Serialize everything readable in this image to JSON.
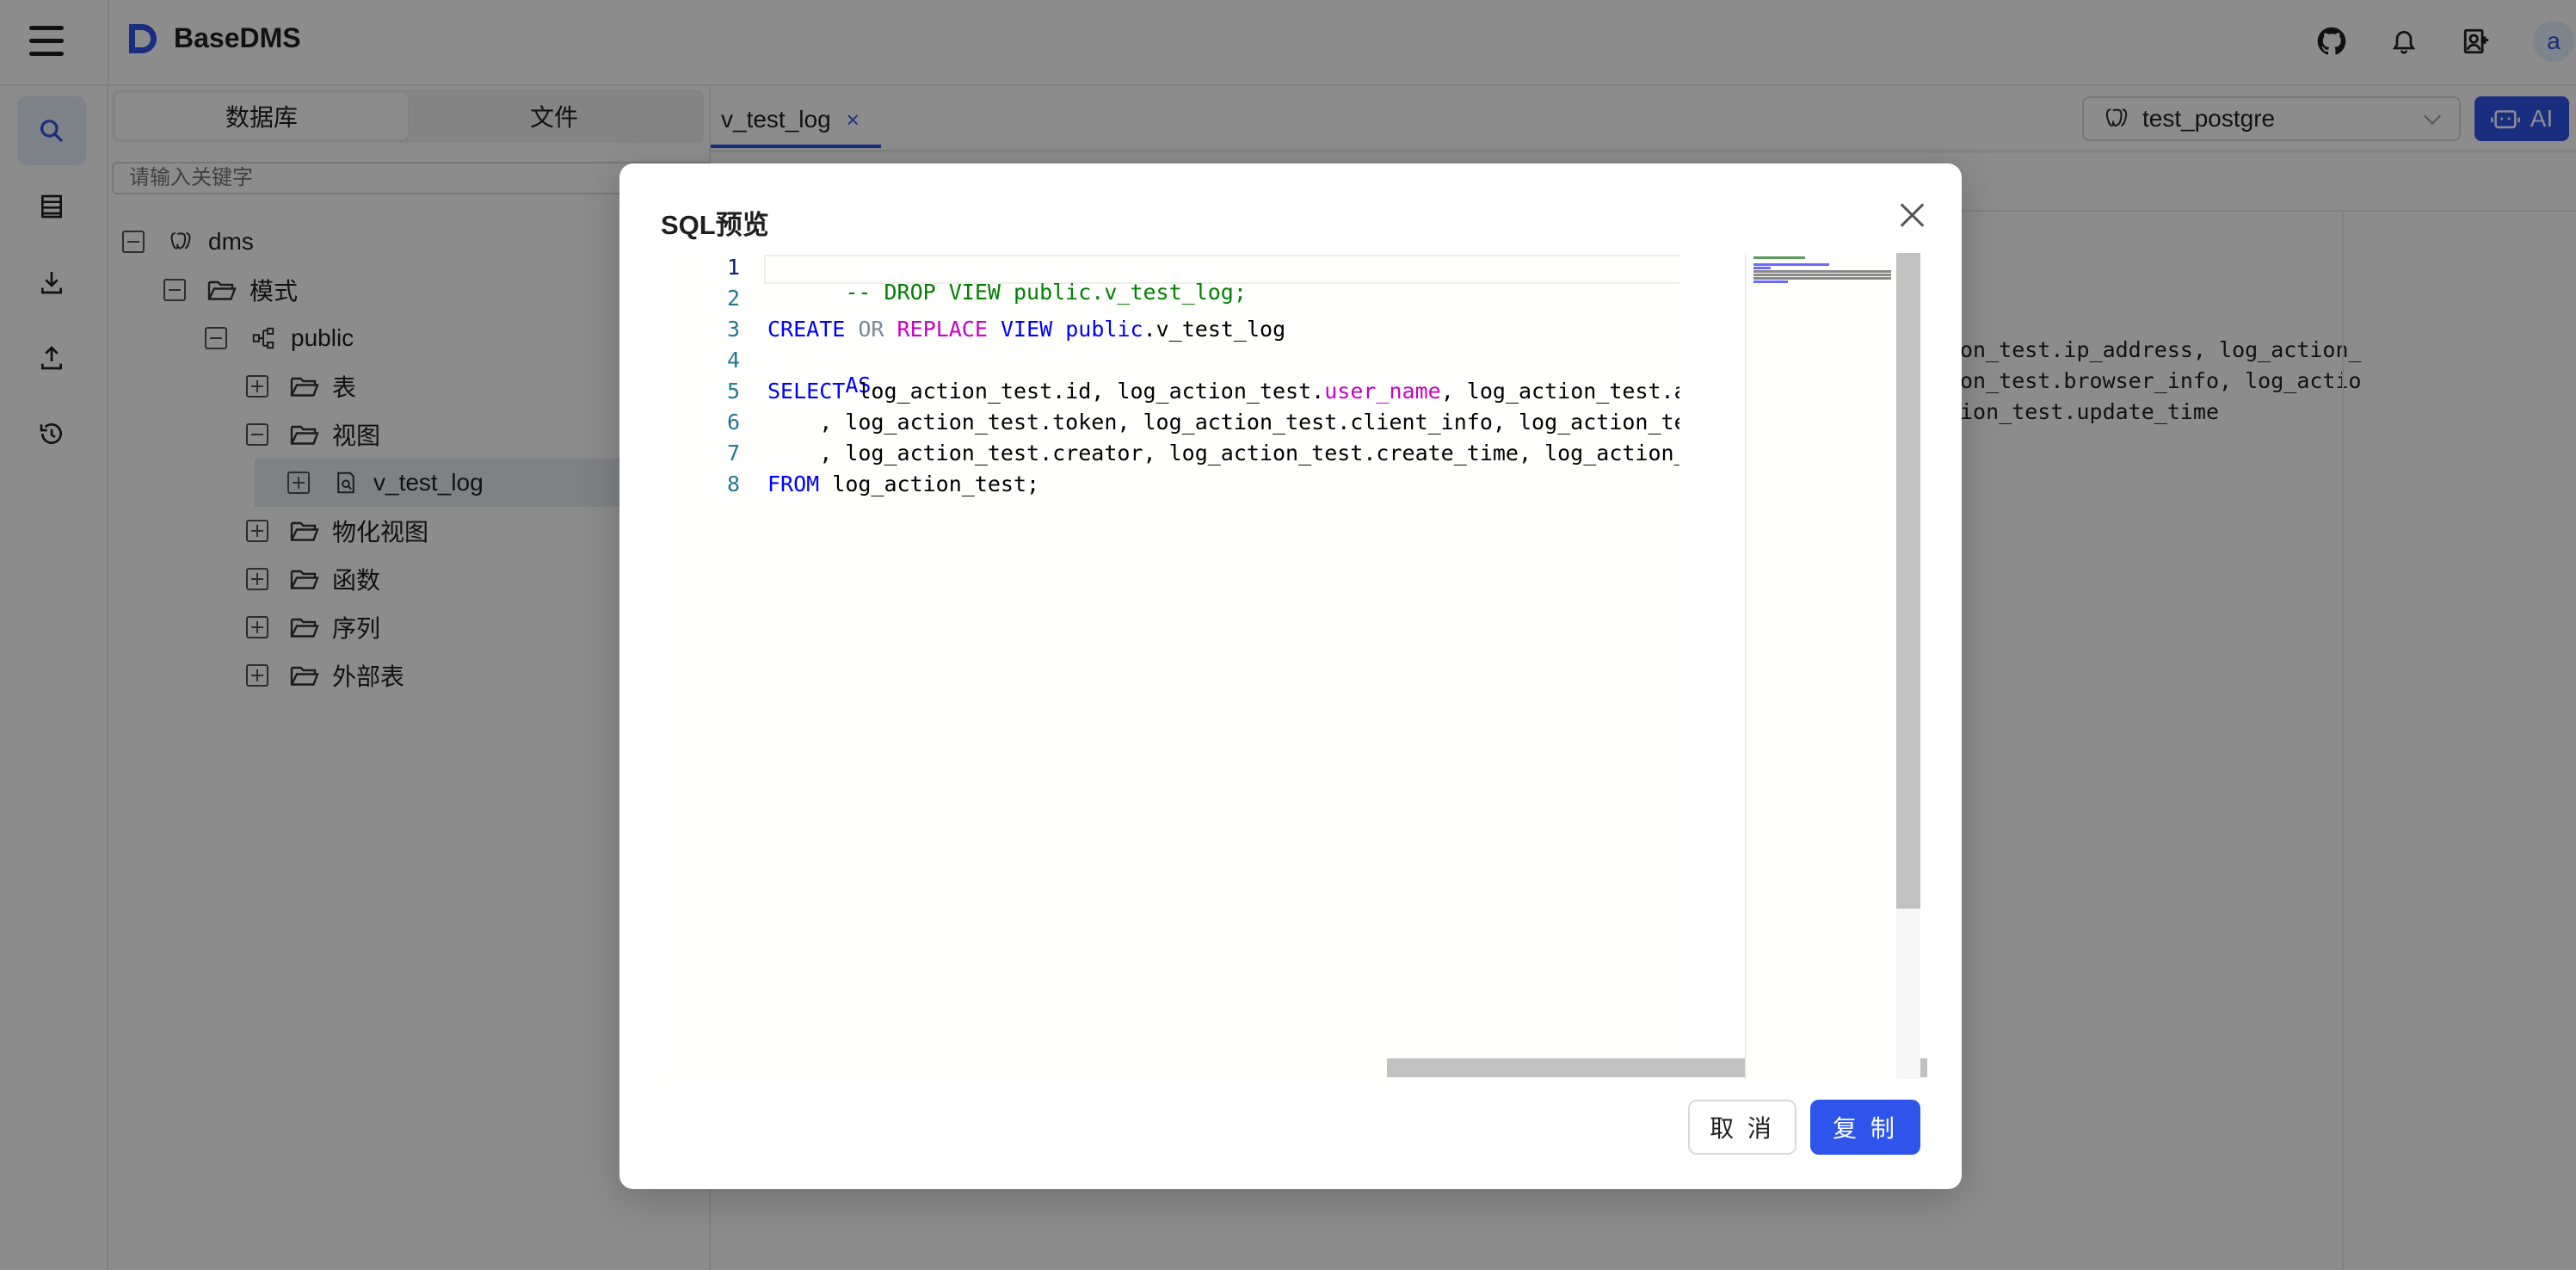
{
  "app": {
    "title": "BaseDMS",
    "avatar_letter": "a"
  },
  "header_icons": [
    "github-icon",
    "bell-icon",
    "user-add-icon"
  ],
  "rail": {
    "items": [
      "search-icon",
      "table-icon",
      "download-icon",
      "upload-icon",
      "history-icon"
    ],
    "active": "search-icon"
  },
  "sidebar": {
    "tabs": [
      {
        "label": "数据库",
        "active": true
      },
      {
        "label": "文件",
        "active": false
      }
    ],
    "search_placeholder": "请输入关键字",
    "tree": {
      "root": "dms",
      "schema": "模式",
      "public": "public",
      "tables": "表",
      "views": "视图",
      "view_item": "v_test_log",
      "mviews": "物化视图",
      "functions": "函数",
      "sequences": "序列",
      "foreign_tables": "外部表"
    }
  },
  "editor": {
    "tab_label": "v_test_log",
    "tab_close": "×",
    "db_select": "test_postgre",
    "ai_label": "AI",
    "background_lines": [
      "on_test.ip_address, log_action_",
      "on_test.browser_info, log_actio",
      "ion_test.update_time"
    ]
  },
  "modal": {
    "title": "SQL预览",
    "line_numbers": [
      "1",
      "2",
      "3",
      "4",
      "5",
      "6",
      "7",
      "8"
    ],
    "code": {
      "l1": "-- DROP VIEW public.v_test_log;",
      "l3_a": "CREATE",
      "l3_b": "OR",
      "l3_c": "REPLACE",
      "l3_d": "VIEW",
      "l3_e": "public",
      "l3_f": ".v_test_log",
      "l4": "AS",
      "l5_a": "SELECT",
      "l5_b": " log_action_test.id, log_action_test.",
      "l5_c": "user_name",
      "l5_d": ", log_action_test.action_ti",
      "l6": "    , log_action_test.token, log_action_test.client_info, log_action_test.os_in",
      "l7": "    , log_action_test.creator, log_action_test.create_time, log_action_test.edi",
      "l8_a": "FROM",
      "l8_b": " log_action_test;"
    },
    "cancel_label": "取 消",
    "copy_label": "复 制"
  },
  "colors": {
    "primary": "#2f54eb",
    "overlay": "rgba(0,0,0,0.45)",
    "keyword": "#0000ff",
    "comment": "#008000",
    "function": "#c800c8"
  }
}
